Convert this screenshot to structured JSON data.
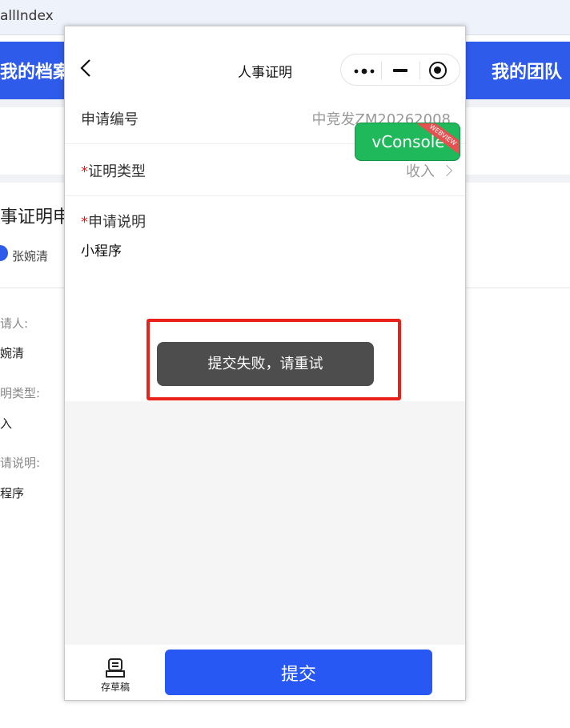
{
  "background": {
    "tab_title": "allIndex",
    "header_left": "我的档案",
    "header_right": "我的团队",
    "page_title": "事证明申",
    "user_name": "张婉清",
    "fields": [
      {
        "label": "请人:",
        "value": "婉清"
      },
      {
        "label": "明类型:",
        "value": "入"
      },
      {
        "label": "请说明:",
        "value": "程序"
      }
    ]
  },
  "nav": {
    "title": "人事证明",
    "back_icon": "chevron-left-icon",
    "more_icon": "more-dots-icon",
    "minimize_icon": "minimize-icon",
    "close_icon": "target-close-icon"
  },
  "form": {
    "app_no_label": "申请编号",
    "app_no_value": "中竞发ZM20262008",
    "type_label": "证明类型",
    "type_value": "收入",
    "desc_label": "申请说明",
    "desc_value": "小程序",
    "required_mark": "*"
  },
  "vconsole": {
    "label": "vConsole",
    "ribbon": "WEBVIEW",
    "color": "#1fb85b"
  },
  "toast": {
    "message": "提交失败，请重试"
  },
  "bottom": {
    "draft_label": "存草稿",
    "draft_icon": "draft-icon",
    "submit_label": "提交",
    "submit_color": "#2858f3"
  }
}
